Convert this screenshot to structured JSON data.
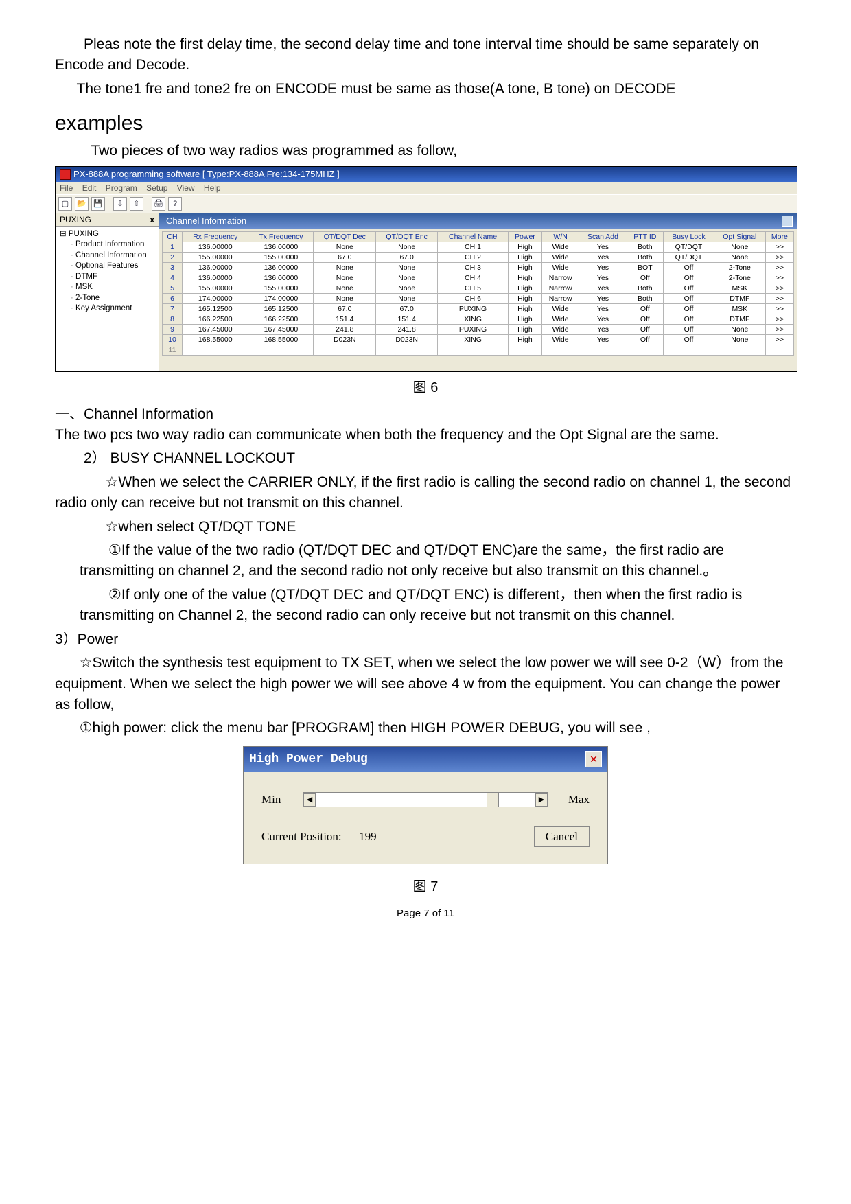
{
  "intro": {
    "p1": "Pleas note the first delay time, the second delay time and tone interval time should be same separately on Encode and Decode.",
    "p2": "The tone1 fre and tone2 fre on ENCODE must be same as those(A tone, B tone) on DECODE"
  },
  "examples_heading": "examples",
  "examples_intro": "Two pieces of two way radios was programmed as follow,",
  "app": {
    "title": "PX-888A programming software  [ Type:PX-888A  Fre:134-175MHZ ]",
    "menubar": [
      "File",
      "Edit",
      "Program",
      "Setup",
      "View",
      "Help"
    ],
    "toolbar_icons": [
      "new-file-icon",
      "open-icon",
      "save-icon",
      "divider",
      "download-icon",
      "upload-icon",
      "divider",
      "print-icon",
      "help-icon"
    ],
    "left_tab_label": "PUXING",
    "tree_root": "PUXING",
    "tree_children": [
      "Product Information",
      "Channel Information",
      "Optional Features",
      "DTMF",
      "MSK",
      "2-Tone",
      "Key Assignment"
    ],
    "channel_title": "Channel Information",
    "columns": [
      "CH",
      "Rx Frequency",
      "Tx Frequency",
      "QT/DQT Dec",
      "QT/DQT Enc",
      "Channel Name",
      "Power",
      "W/N",
      "Scan Add",
      "PTT ID",
      "Busy Lock",
      "Opt Signal",
      "More"
    ],
    "rows": [
      {
        "n": "1",
        "rx": "136.00000",
        "tx": "136.00000",
        "dec": "None",
        "enc": "None",
        "name": "CH   1",
        "pow": "High",
        "wn": "Wide",
        "scan": "Yes",
        "ptt": "Both",
        "busy": "QT/DQT",
        "opt": "None",
        "more": ">>"
      },
      {
        "n": "2",
        "rx": "155.00000",
        "tx": "155.00000",
        "dec": "67.0",
        "enc": "67.0",
        "name": "CH   2",
        "pow": "High",
        "wn": "Wide",
        "scan": "Yes",
        "ptt": "Both",
        "busy": "QT/DQT",
        "opt": "None",
        "more": ">>"
      },
      {
        "n": "3",
        "rx": "136.00000",
        "tx": "136.00000",
        "dec": "None",
        "enc": "None",
        "name": "CH   3",
        "pow": "High",
        "wn": "Wide",
        "scan": "Yes",
        "ptt": "BOT",
        "busy": "Off",
        "opt": "2-Tone",
        "more": ">>"
      },
      {
        "n": "4",
        "rx": "136.00000",
        "tx": "136.00000",
        "dec": "None",
        "enc": "None",
        "name": "CH   4",
        "pow": "High",
        "wn": "Narrow",
        "scan": "Yes",
        "ptt": "Off",
        "busy": "Off",
        "opt": "2-Tone",
        "more": ">>"
      },
      {
        "n": "5",
        "rx": "155.00000",
        "tx": "155.00000",
        "dec": "None",
        "enc": "None",
        "name": "CH   5",
        "pow": "High",
        "wn": "Narrow",
        "scan": "Yes",
        "ptt": "Both",
        "busy": "Off",
        "opt": "MSK",
        "more": ">>"
      },
      {
        "n": "6",
        "rx": "174.00000",
        "tx": "174.00000",
        "dec": "None",
        "enc": "None",
        "name": "CH   6",
        "pow": "High",
        "wn": "Narrow",
        "scan": "Yes",
        "ptt": "Both",
        "busy": "Off",
        "opt": "DTMF",
        "more": ">>"
      },
      {
        "n": "7",
        "rx": "165.12500",
        "tx": "165.12500",
        "dec": "67.0",
        "enc": "67.0",
        "name": "PUXING",
        "pow": "High",
        "wn": "Wide",
        "scan": "Yes",
        "ptt": "Off",
        "busy": "Off",
        "opt": "MSK",
        "more": ">>"
      },
      {
        "n": "8",
        "rx": "166.22500",
        "tx": "166.22500",
        "dec": "151.4",
        "enc": "151.4",
        "name": "XING",
        "pow": "High",
        "wn": "Wide",
        "scan": "Yes",
        "ptt": "Off",
        "busy": "Off",
        "opt": "DTMF",
        "more": ">>"
      },
      {
        "n": "9",
        "rx": "167.45000",
        "tx": "167.45000",
        "dec": "241.8",
        "enc": "241.8",
        "name": "PUXING",
        "pow": "High",
        "wn": "Wide",
        "scan": "Yes",
        "ptt": "Off",
        "busy": "Off",
        "opt": "None",
        "more": ">>"
      },
      {
        "n": "10",
        "rx": "168.55000",
        "tx": "168.55000",
        "dec": "D023N",
        "enc": "D023N",
        "name": "XING",
        "pow": "High",
        "wn": "Wide",
        "scan": "Yes",
        "ptt": "Off",
        "busy": "Off",
        "opt": "None",
        "more": ">>"
      }
    ],
    "blank_row_num": "11"
  },
  "fig6_caption": "图 6",
  "section1_label": "一、Channel Information",
  "section1_body": "The two pcs two way radio can communicate when both the frequency and the Opt Signal are the same.",
  "sec2_label": "2）  BUSY CHANNEL LOCKOUT",
  "sec2_star1": "☆When we select the CARRIER ONLY, if the first radio is calling the second radio on channel 1, the second radio only can receive but not transmit on this channel.",
  "sec2_star2": "☆when select QT/DQT TONE",
  "sec2_c1": "①If the value of the two radio (QT/DQT DEC and QT/DQT ENC)are the same，the first radio are transmitting on channel 2, and the second radio not only receive but also transmit on this channel.。",
  "sec2_c2": "②If only one of the value (QT/DQT DEC and QT/DQT ENC) is different，then when the first radio is transmitting on Channel 2, the second radio can only receive but not transmit on this channel.",
  "sec3_label": "3）Power",
  "sec3_s1": "☆Switch the synthesis test equipment to TX SET, when we select the low power we will see 0-2（W）from the equipment.   When we select the high power we will see above 4 w from the equipment. You can change the power as follow,",
  "sec3_c1": "①high power: click the menu bar [PROGRAM] then HIGH POWER DEBUG, you will see ,",
  "dlg": {
    "title": "High Power Debug",
    "min": "Min",
    "max": "Max",
    "pos_label": "Current Position:",
    "pos_value": "199",
    "cancel": "Cancel"
  },
  "fig7_caption": "图 7",
  "page_footer": "Page 7 of 11"
}
